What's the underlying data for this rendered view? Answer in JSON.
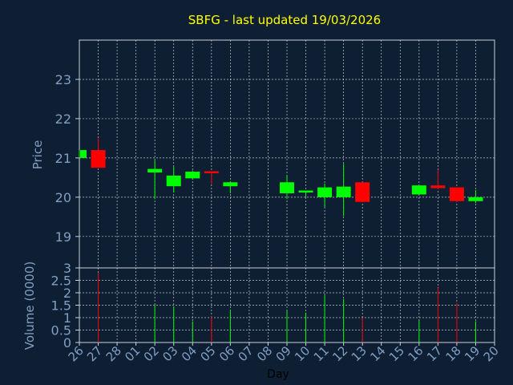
{
  "chart_data": {
    "type": "candlestick",
    "title": "SBFG - last updated 19/03/2026",
    "xlabel": "Day",
    "x_ticks": [
      "26",
      "27",
      "28",
      "01",
      "02",
      "03",
      "04",
      "05",
      "06",
      "07",
      "08",
      "09",
      "10",
      "11",
      "12",
      "13",
      "14",
      "15",
      "16",
      "17",
      "18",
      "19",
      "20"
    ],
    "colors": {
      "background": "#0f1f33",
      "title": "#ffff00",
      "axis_text": "#7f9fc4",
      "xlabel": "#000000",
      "up": "#00ff00",
      "down": "#ff0000",
      "grid": "#ffffff"
    },
    "price_panel": {
      "ylabel": "Price",
      "ylim": [
        18.2,
        24.0
      ],
      "yticks": [
        "19",
        "20",
        "21",
        "22",
        "23"
      ],
      "grid": true,
      "candles": [
        {
          "day": "26",
          "open": 21.0,
          "close": 21.2,
          "high": 21.2,
          "low": 21.0
        },
        {
          "day": "27",
          "open": 21.2,
          "close": 20.75,
          "high": 21.5,
          "low": 20.75
        },
        {
          "day": "02",
          "open": 20.63,
          "close": 20.72,
          "high": 20.95,
          "low": 19.95
        },
        {
          "day": "03",
          "open": 20.28,
          "close": 20.55,
          "high": 20.78,
          "low": 20.12
        },
        {
          "day": "04",
          "open": 20.48,
          "close": 20.65,
          "high": 20.68,
          "low": 20.45
        },
        {
          "day": "05",
          "open": 20.66,
          "close": 20.61,
          "high": 20.66,
          "low": 20.33
        },
        {
          "day": "06",
          "open": 20.28,
          "close": 20.38,
          "high": 20.4,
          "low": 20.1
        },
        {
          "day": "09",
          "open": 20.1,
          "close": 20.38,
          "high": 20.55,
          "low": 19.95
        },
        {
          "day": "10",
          "open": 20.12,
          "close": 20.17,
          "high": 20.17,
          "low": 20.0
        },
        {
          "day": "11",
          "open": 20.0,
          "close": 20.25,
          "high": 20.35,
          "low": 19.75
        },
        {
          "day": "12",
          "open": 20.0,
          "close": 20.27,
          "high": 20.85,
          "low": 19.52
        },
        {
          "day": "13",
          "open": 20.38,
          "close": 19.88,
          "high": 20.38,
          "low": 19.88
        },
        {
          "day": "16",
          "open": 20.07,
          "close": 20.3,
          "high": 20.3,
          "low": 20.07
        },
        {
          "day": "17",
          "open": 20.3,
          "close": 20.23,
          "high": 20.7,
          "low": 20.2
        },
        {
          "day": "18",
          "open": 20.25,
          "close": 19.9,
          "high": 20.25,
          "low": 19.88
        },
        {
          "day": "19",
          "open": 19.9,
          "close": 20.0,
          "high": 20.18,
          "low": 19.85
        }
      ]
    },
    "volume_panel": {
      "ylabel": "Volume (0000)",
      "ylim": [
        0,
        3
      ],
      "yticks": [
        "0",
        "0.5",
        "1",
        "1.5",
        "2",
        "2.5",
        "3"
      ],
      "grid": true,
      "bars": [
        {
          "day": "27",
          "value": 2.8,
          "direction": "down"
        },
        {
          "day": "02",
          "value": 1.5,
          "direction": "up"
        },
        {
          "day": "03",
          "value": 1.45,
          "direction": "up"
        },
        {
          "day": "04",
          "value": 0.85,
          "direction": "up"
        },
        {
          "day": "05",
          "value": 1.05,
          "direction": "down"
        },
        {
          "day": "06",
          "value": 1.3,
          "direction": "up"
        },
        {
          "day": "09",
          "value": 1.3,
          "direction": "up"
        },
        {
          "day": "10",
          "value": 1.2,
          "direction": "up"
        },
        {
          "day": "11",
          "value": 1.9,
          "direction": "up"
        },
        {
          "day": "12",
          "value": 1.75,
          "direction": "up"
        },
        {
          "day": "13",
          "value": 1.0,
          "direction": "down"
        },
        {
          "day": "16",
          "value": 0.9,
          "direction": "up"
        },
        {
          "day": "17",
          "value": 2.2,
          "direction": "down"
        },
        {
          "day": "18",
          "value": 1.6,
          "direction": "down"
        },
        {
          "day": "19",
          "value": 0.85,
          "direction": "up"
        }
      ]
    }
  }
}
